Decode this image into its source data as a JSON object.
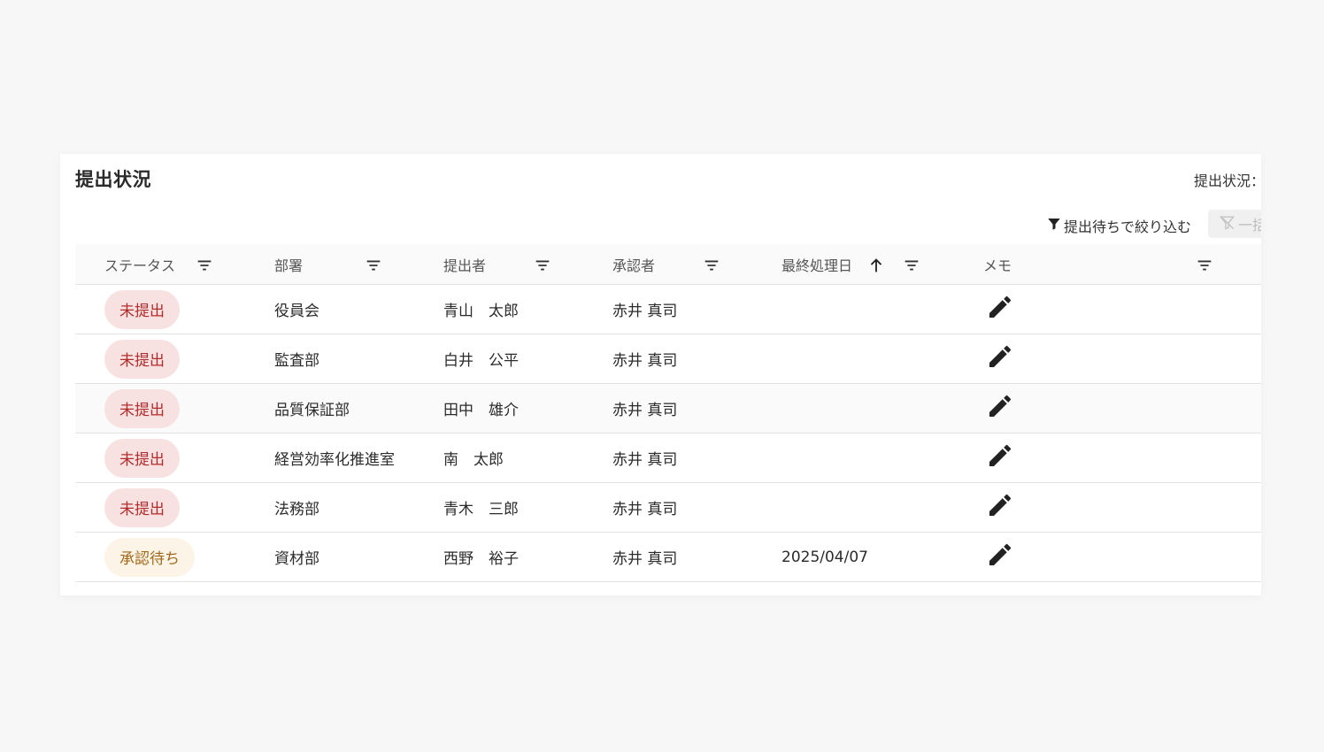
{
  "card": {
    "title": "提出状況",
    "status_summary": "提出状況："
  },
  "toolbar": {
    "filter_pending_label": "提出待ちで絞り込む",
    "clear_filter_label": "一括"
  },
  "table": {
    "columns": [
      {
        "label": "ステータス"
      },
      {
        "label": "部署"
      },
      {
        "label": "提出者"
      },
      {
        "label": "承認者"
      },
      {
        "label": "最終処理日"
      },
      {
        "label": "メモ"
      }
    ],
    "rows": [
      {
        "status": "未提出",
        "status_kind": "unsubmitted",
        "department": "役員会",
        "submitter": "青山　太郎",
        "approver": "赤井 真司",
        "last_processed": ""
      },
      {
        "status": "未提出",
        "status_kind": "unsubmitted",
        "department": "監査部",
        "submitter": "白井　公平",
        "approver": "赤井 真司",
        "last_processed": ""
      },
      {
        "status": "未提出",
        "status_kind": "unsubmitted",
        "department": "品質保証部",
        "submitter": "田中　雄介",
        "approver": "赤井 真司",
        "last_processed": ""
      },
      {
        "status": "未提出",
        "status_kind": "unsubmitted",
        "department": "経営効率化推進室",
        "submitter": "南　太郎",
        "approver": "赤井 真司",
        "last_processed": ""
      },
      {
        "status": "未提出",
        "status_kind": "unsubmitted",
        "department": "法務部",
        "submitter": "青木　三郎",
        "approver": "赤井 真司",
        "last_processed": ""
      },
      {
        "status": "承認待ち",
        "status_kind": "pending",
        "department": "資材部",
        "submitter": "西野　裕子",
        "approver": "赤井 真司",
        "last_processed": "2025/04/07"
      }
    ]
  },
  "icons": {
    "column_filter": "filter-list-icon",
    "sort": "arrow-upward-icon",
    "memo": "pencil-icon",
    "filter_button": "funnel-icon",
    "clear_filter": "funnel-off-icon"
  },
  "colors": {
    "unsubmitted_bg": "#f8e1e1",
    "unsubmitted_text": "#b22c2c",
    "pending_bg": "#fcf4e6",
    "pending_text": "#a3681b"
  }
}
